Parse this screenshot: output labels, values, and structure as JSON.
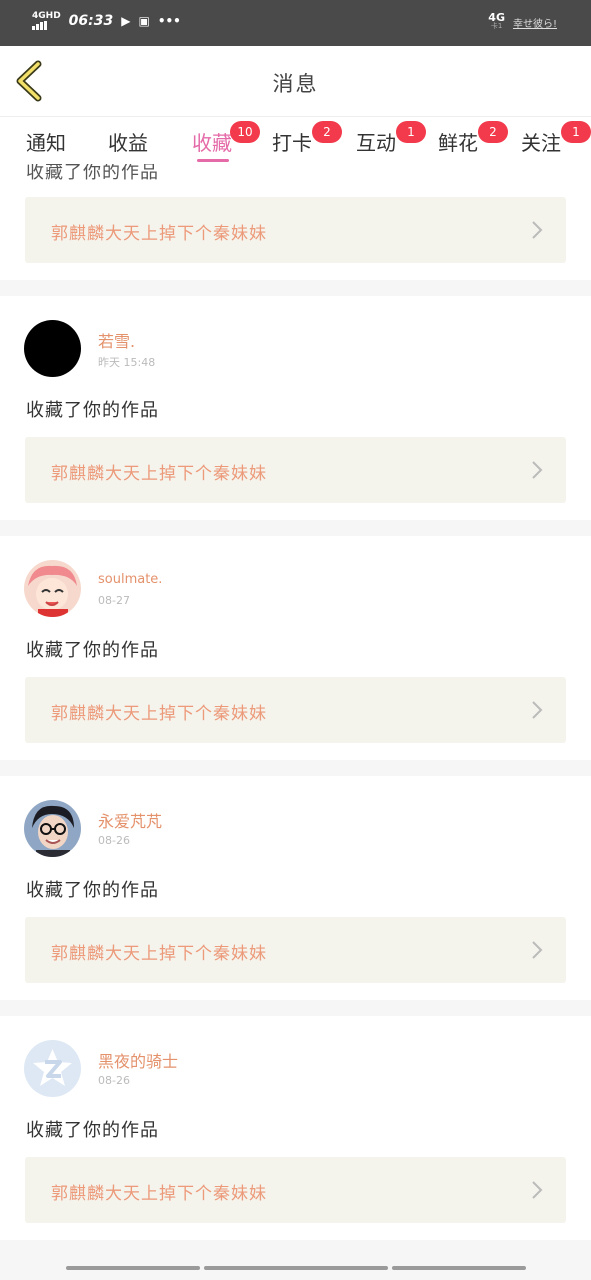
{
  "status": {
    "network": "4G",
    "hd": "HD",
    "time": "06:33",
    "right_net": "4G",
    "right_sub": "卡1",
    "right_text": "幸せ彼ら!"
  },
  "header": {
    "title": "消息"
  },
  "tabs": [
    {
      "label": "通知",
      "badge": ""
    },
    {
      "label": "收益",
      "badge": ""
    },
    {
      "label": "收藏",
      "badge": "10",
      "active": true
    },
    {
      "label": "打卡",
      "badge": "2"
    },
    {
      "label": "互动",
      "badge": "1"
    },
    {
      "label": "鲜花",
      "badge": "2"
    },
    {
      "label": "关注",
      "badge": "1"
    }
  ],
  "partial": {
    "action": "收藏了你的作品",
    "work": "郭麒麟大天上掉下个秦妹妹"
  },
  "items": [
    {
      "name": "若雪.",
      "time": "昨天 15:48",
      "action": "收藏了你的作品",
      "work": "郭麒麟大天上掉下个秦妹妹",
      "avatar": "black-avatar"
    },
    {
      "name": "soulmate.",
      "time": "08-27",
      "action": "收藏了你的作品",
      "work": "郭麒麟大天上掉下个秦妹妹",
      "avatar": "anime-avatar"
    },
    {
      "name": "永爱芃芃",
      "time": "08-26",
      "action": "收藏了你的作品",
      "work": "郭麒麟大天上掉下个秦妹妹",
      "avatar": "photo-avatar"
    },
    {
      "name": "黑夜的骑士",
      "time": "08-26",
      "action": "收藏了你的作品",
      "work": "郭麒麟大天上掉下个秦妹妹",
      "avatar": "qzone-avatar"
    }
  ],
  "colors": {
    "accent": "#e56aa8",
    "badge": "#f23a4c",
    "name": "#e4926c",
    "work_text": "#ec9a7a",
    "work_bg": "#f4f3ec"
  }
}
